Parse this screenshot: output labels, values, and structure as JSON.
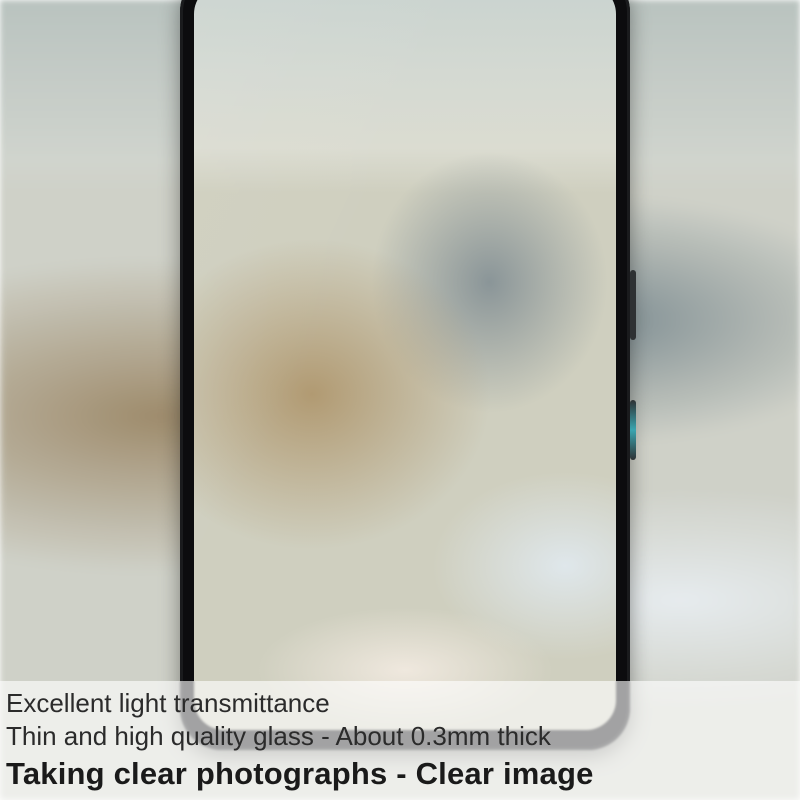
{
  "caption": {
    "line1": "Excellent light transmittance",
    "line2": "Thin and high quality glass - About 0.3mm thick",
    "line3": "Taking clear photographs - Clear image"
  }
}
